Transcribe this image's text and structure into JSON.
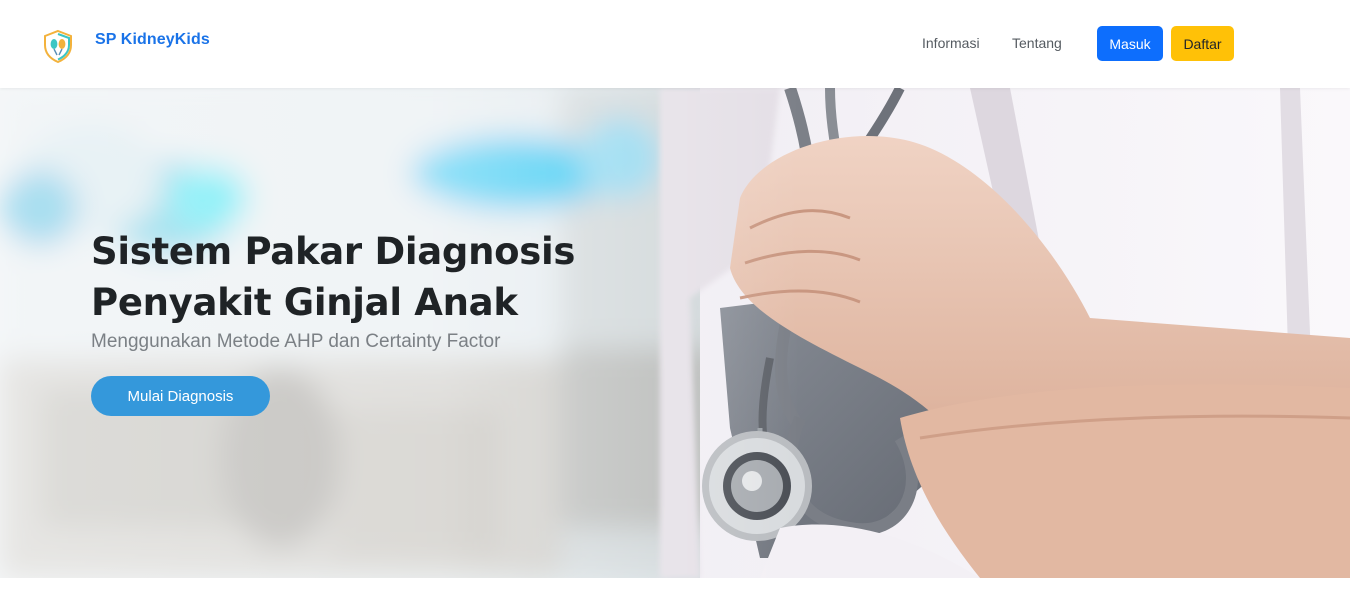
{
  "navbar": {
    "brand": "SP KidneyKids",
    "logo_icon": "kidney-shield-icon",
    "links": [
      "Informasi",
      "Tentang"
    ],
    "login_label": "Masuk",
    "register_label": "Daftar"
  },
  "hero": {
    "title_line1": "Sistem Pakar Diagnosis",
    "title_line2": "Penyakit Ginjal Anak",
    "subtitle": "Menggunakan Metode AHP dan Certainty Factor",
    "cta_label": "Mulai Diagnosis",
    "background_image": "doctor-with-stethoscope-image"
  },
  "colors": {
    "brand": "#1a73e8",
    "login_button": "#0d6efd",
    "register_button": "#ffc107",
    "cta_button": "#3498db"
  }
}
